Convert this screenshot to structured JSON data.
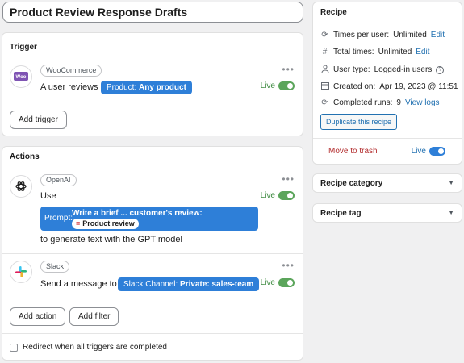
{
  "recipe_title": "Product Review Response Drafts",
  "trigger": {
    "heading": "Trigger",
    "app_tag": "WooCommerce",
    "sentence": "A user reviews",
    "token_key": "Product:",
    "token_value": "Any product",
    "live_label": "Live",
    "add_button": "Add trigger"
  },
  "actions": {
    "heading": "Actions",
    "items": [
      {
        "app_tag": "OpenAI",
        "use_text": "Use",
        "prompt_label": "Prompt:",
        "prompt_text": "Write a brief ... customer's review:",
        "prompt_token": "Product review",
        "suffix": "to generate text with the GPT model",
        "live_label": "Live"
      },
      {
        "app_tag": "Slack",
        "sentence": "Send a message to",
        "token_key": "Slack Channel:",
        "token_value": "Private: sales-team",
        "live_label": "Live"
      }
    ],
    "add_action": "Add action",
    "add_filter": "Add filter",
    "redirect_label": "Redirect when all triggers are completed"
  },
  "recipe": {
    "heading": "Recipe",
    "rows": [
      {
        "icon": "refresh-icon",
        "label": "Times per user:",
        "value": "Unlimited",
        "link": "Edit"
      },
      {
        "icon": "hash-icon",
        "label": "Total times:",
        "value": "Unlimited",
        "link": "Edit"
      },
      {
        "icon": "user-icon",
        "label": "User type:",
        "value": "Logged-in users",
        "link": ""
      },
      {
        "icon": "calendar-icon",
        "label": "Created on:",
        "value": "Apr 19, 2023 @ 11:51",
        "link": ""
      },
      {
        "icon": "refresh-icon",
        "label": "Completed runs:",
        "value": "9",
        "link": "View logs"
      }
    ],
    "duplicate_button": "Duplicate this recipe",
    "trash_link": "Move to trash",
    "live_label": "Live"
  },
  "recipe_category": "Recipe category",
  "recipe_tag": "Recipe tag",
  "colors": {
    "accent": "#2e7fd8",
    "live_green": "#3c8a3f",
    "trash_red": "#b32d2e"
  }
}
